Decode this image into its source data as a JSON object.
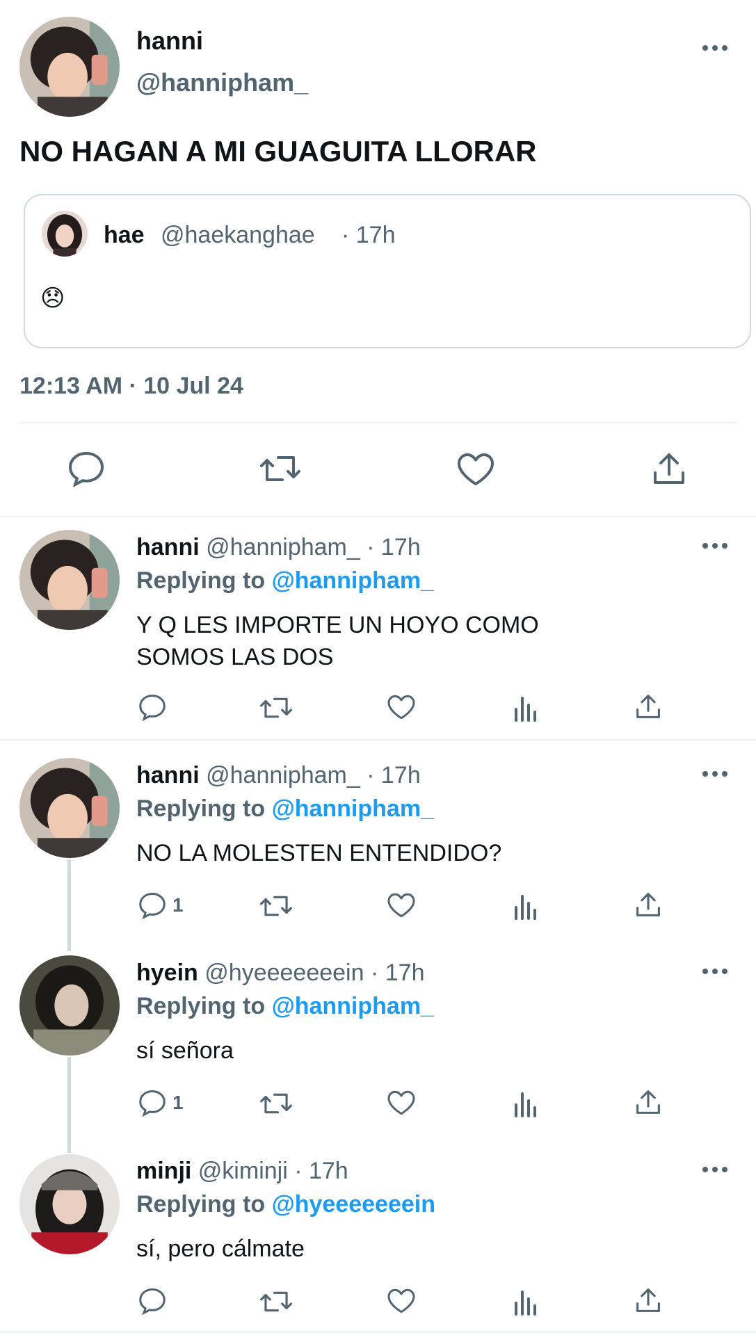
{
  "main_tweet": {
    "display_name": "hanni",
    "handle": "@hannipham_",
    "text": "NO HAGAN A MI GUAGUITA LLORAR",
    "timestamp": "12:13 AM · 10 Jul 24",
    "quoted": {
      "display_name": "hae",
      "handle": "@haekanghae",
      "time": "· 17h",
      "emoji": "😞"
    }
  },
  "replies": [
    {
      "display_name": "hanni",
      "handle": "@hannipham_",
      "time": "· 17h",
      "replying_prefix": "Replying to",
      "replying_to": "@hannipham_",
      "text_lines": [
        "Y Q LES IMPORTE UN HOYO COMO",
        "SOMOS LAS DOS"
      ],
      "reply_count": ""
    },
    {
      "display_name": "hanni",
      "handle": "@hannipham_",
      "time": "· 17h",
      "replying_prefix": "Replying to",
      "replying_to": "@hannipham_",
      "text_lines": [
        "NO LA MOLESTEN ENTENDIDO?"
      ],
      "reply_count": "1"
    },
    {
      "display_name": "hyein",
      "handle": "@hyeeeeeeein",
      "time": "· 17h",
      "replying_prefix": "Replying to",
      "replying_to": "@hannipham_",
      "text_lines": [
        "sí señora"
      ],
      "reply_count": "1"
    },
    {
      "display_name": "minji",
      "handle": "@kiminji",
      "time": "· 17h",
      "replying_prefix": "Replying to",
      "replying_to": "@hyeeeeeeein",
      "text_lines": [
        "sí, pero cálmate"
      ],
      "reply_count": ""
    }
  ],
  "colors": {
    "text": "#0f1419",
    "secondary": "#536471",
    "accent": "#1d9bf0",
    "border": "#cfd9de",
    "divider": "#eff3f4"
  },
  "icons": [
    "reply-icon",
    "retweet-icon",
    "like-icon",
    "views-icon",
    "share-icon",
    "more-icon"
  ]
}
